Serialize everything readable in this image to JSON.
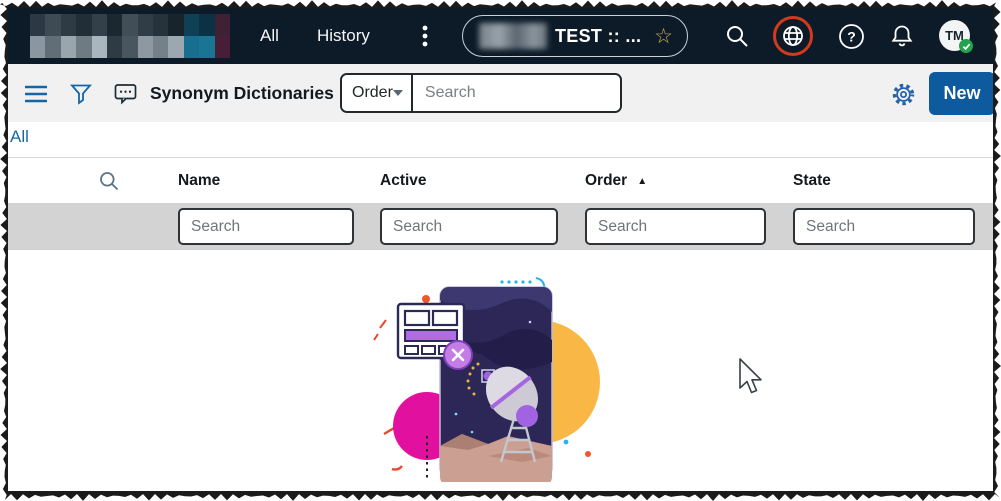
{
  "topbar": {
    "logo_redacted": true,
    "logo_mosaic": [
      "#2c3944",
      "#3e4b54",
      "#2e3b44",
      "#222e37",
      "#33404a",
      "#1c2830",
      "#414e57",
      "#303d46",
      "#26323c",
      "#18242c",
      "#0f4156",
      "#0b3145",
      "#3f2136",
      "#8a96a0",
      "#626e77",
      "#9aa6ae",
      "#6f7b83",
      "#aab6bd",
      "#2e3b44",
      "#485660",
      "#8d98a1",
      "#75818a",
      "#9ca8b0",
      "#176e8e",
      "#1a7494",
      "#471e38"
    ],
    "nav": [
      {
        "label": "All"
      },
      {
        "label": "History"
      }
    ],
    "environment": {
      "label": "TEST :: ...",
      "star_glyph": "☆",
      "prefix_redacted": true
    },
    "help_glyph": "?",
    "avatar": {
      "initials": "TM",
      "status": "verified"
    }
  },
  "toolbar": {
    "title": "Synonym Dictionaries",
    "scope_selector": {
      "value": "Order"
    },
    "search": {
      "placeholder": "Search",
      "value": ""
    },
    "new_button_label": "New"
  },
  "tabs": [
    {
      "label": "All"
    }
  ],
  "table": {
    "columns": [
      {
        "label": "Name",
        "sorted": null
      },
      {
        "label": "Active",
        "sorted": null
      },
      {
        "label": "Order",
        "sorted": "asc",
        "sort_indicator": "▲"
      },
      {
        "label": "State",
        "sorted": null
      }
    ],
    "filters": [
      {
        "placeholder": "Search",
        "value": ""
      },
      {
        "placeholder": "Search",
        "value": ""
      },
      {
        "placeholder": "Search",
        "value": ""
      },
      {
        "placeholder": "Search",
        "value": ""
      }
    ],
    "rows": [],
    "empty_state": "illustration"
  },
  "colors": {
    "topbar_bg": "#0d1b28",
    "accent_blue": "#1565a7",
    "new_button": "#0e5a9e",
    "globe_highlight_ring": "#d23a1b",
    "toolbar_bg": "#f1f1f1",
    "filter_band": "#d3d3d3",
    "link_blue": "#1767a5",
    "status_green": "#23a14c",
    "star_gold": "#cfae4e"
  }
}
